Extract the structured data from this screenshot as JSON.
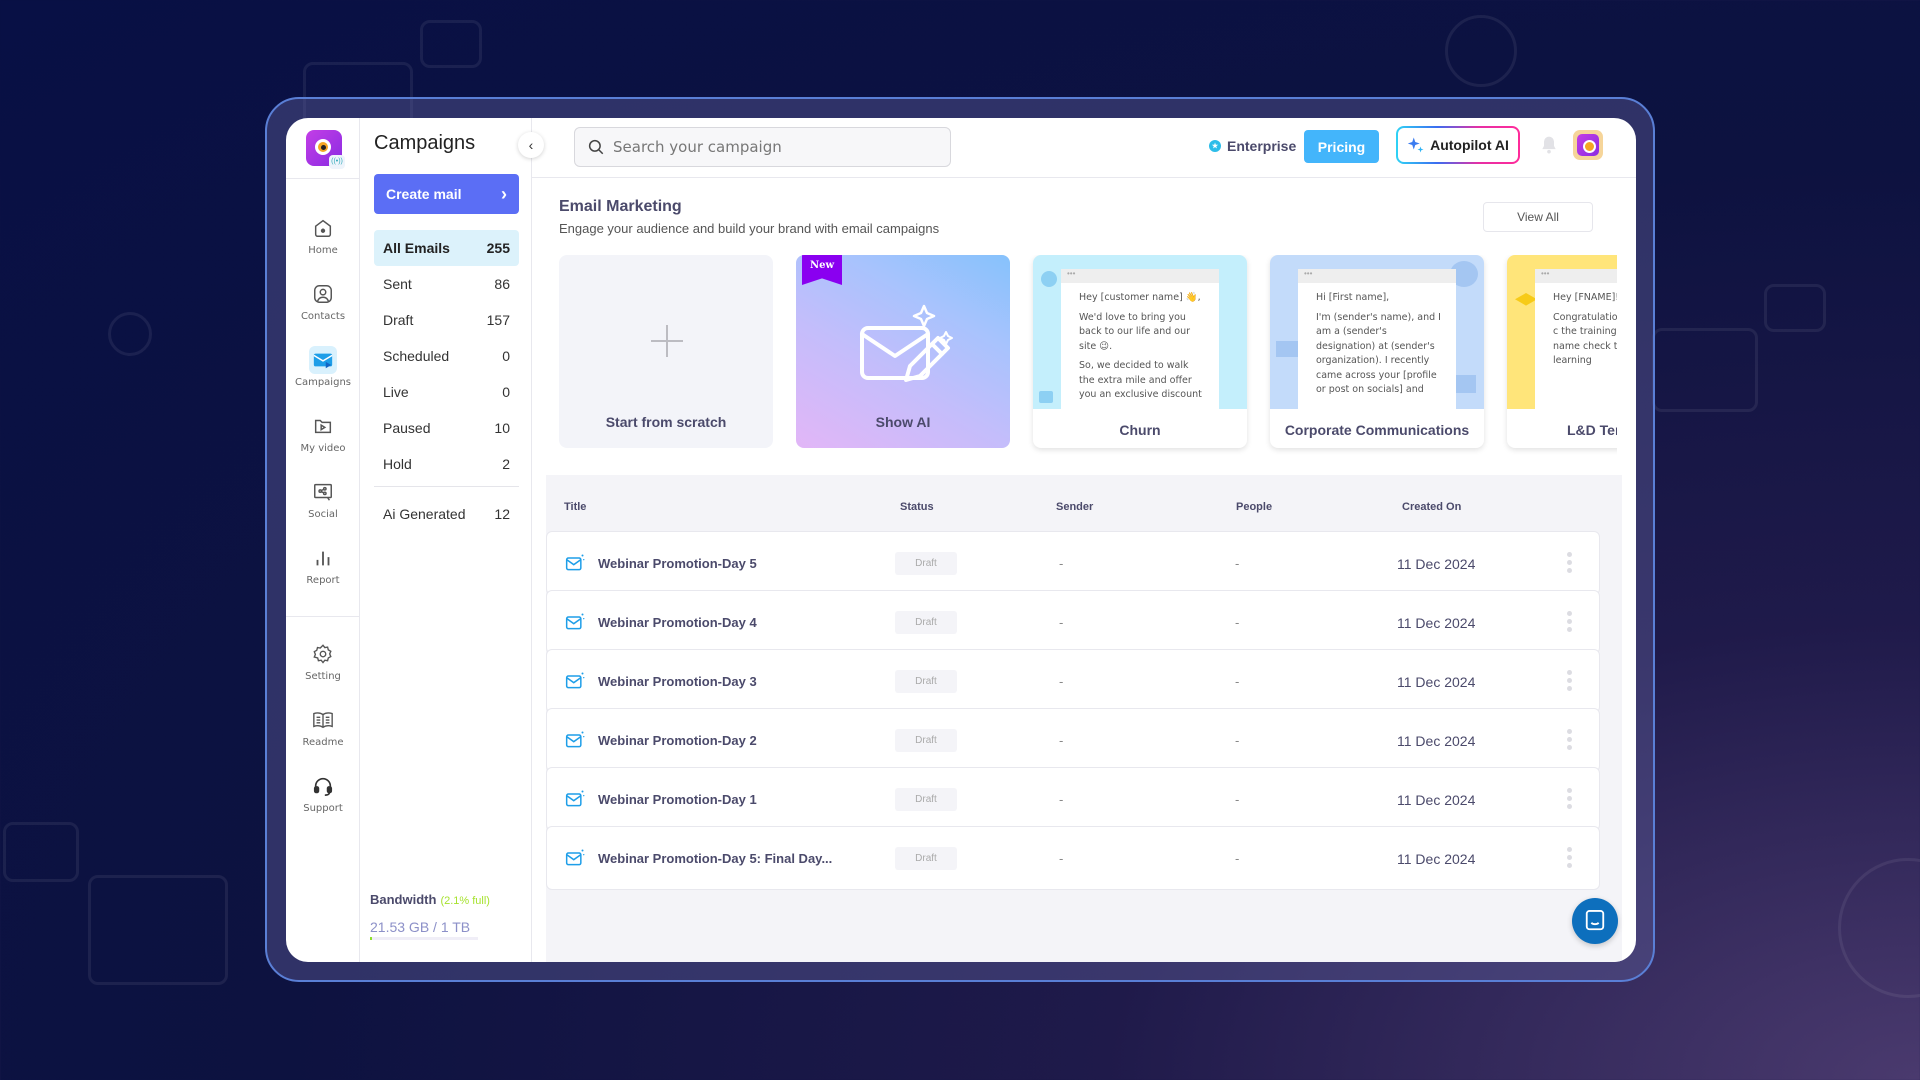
{
  "app": {
    "section_title": "Campaigns",
    "collapse_icon": "chevron-left-icon",
    "create_label": "Create mail"
  },
  "rail": {
    "items": [
      {
        "label": "Home",
        "icon": "home-icon"
      },
      {
        "label": "Contacts",
        "icon": "contacts-icon"
      },
      {
        "label": "Campaigns",
        "icon": "campaigns-icon",
        "active": true
      },
      {
        "label": "My video",
        "icon": "video-icon"
      },
      {
        "label": "Social",
        "icon": "social-icon"
      },
      {
        "label": "Report",
        "icon": "report-icon"
      },
      {
        "label": "Setting",
        "icon": "gear-icon"
      },
      {
        "label": "Readme",
        "icon": "book-icon"
      },
      {
        "label": "Support",
        "icon": "headset-icon"
      }
    ]
  },
  "filters": [
    {
      "label": "All Emails",
      "count": "255",
      "active": true
    },
    {
      "label": "Sent",
      "count": "86"
    },
    {
      "label": "Draft",
      "count": "157"
    },
    {
      "label": "Scheduled",
      "count": "0"
    },
    {
      "label": "Live",
      "count": "0"
    },
    {
      "label": "Paused",
      "count": "10"
    },
    {
      "label": "Hold",
      "count": "2"
    },
    {
      "label": "Ai Generated",
      "count": "12"
    }
  ],
  "bandwidth": {
    "title": "Bandwidth",
    "percent_label": "(2.1% full)",
    "usage": "21.53 GB / 1 TB",
    "fraction": 0.021
  },
  "topbar": {
    "search_placeholder": "Search your campaign",
    "plan_label": "Enterprise",
    "pricing_label": "Pricing",
    "autopilot_label": "Autopilot AI"
  },
  "email_marketing": {
    "title": "Email Marketing",
    "subtitle": "Engage your audience and build your brand with email campaigns",
    "view_all_label": "View All",
    "cards": [
      {
        "label": "Start from scratch"
      },
      {
        "label": "Show AI",
        "ribbon": "New"
      },
      {
        "label": "Churn",
        "color": "#c4effc",
        "preview": [
          "Hey [customer name] 👋,",
          "We'd love to bring you back to our life and our site 😉.",
          "So, we decided to walk the extra mile and offer you an exclusive discount"
        ]
      },
      {
        "label": "Corporate Communications",
        "color": "#c3dbfa",
        "preview": [
          "Hi [First name],",
          "I'm (sender's name), and I am a (sender's designation) at (sender's organization). I recently came across your [profile or post on socials] and"
        ]
      },
      {
        "label": "L&D Ter",
        "color": "#ffe57a",
        "preview": [
          "Hey [FNAME]!",
          "Congratulatio successfully c the training o module name check the pro your learning"
        ]
      }
    ]
  },
  "table": {
    "headers": {
      "title": "Title",
      "status": "Status",
      "sender": "Sender",
      "people": "People",
      "created": "Created On"
    },
    "rows": [
      {
        "title": "Webinar Promotion-Day 5",
        "status": "Draft",
        "sender": "-",
        "people": "-",
        "created": "11 Dec 2024"
      },
      {
        "title": "Webinar Promotion-Day 4",
        "status": "Draft",
        "sender": "-",
        "people": "-",
        "created": "11 Dec 2024"
      },
      {
        "title": "Webinar Promotion-Day 3",
        "status": "Draft",
        "sender": "-",
        "people": "-",
        "created": "11 Dec 2024"
      },
      {
        "title": "Webinar Promotion-Day 2",
        "status": "Draft",
        "sender": "-",
        "people": "-",
        "created": "11 Dec 2024"
      },
      {
        "title": "Webinar Promotion-Day 1",
        "status": "Draft",
        "sender": "-",
        "people": "-",
        "created": "11 Dec 2024"
      },
      {
        "title": "Webinar Promotion-Day 5: Final Day...",
        "status": "Draft",
        "sender": "-",
        "people": "-",
        "created": "11 Dec 2024"
      }
    ]
  },
  "colors": {
    "primary": "#5b6ef5",
    "pricing": "#43b5fb",
    "active_filter_bg": "#dcf2fb",
    "chat": "#0d6fbd"
  }
}
